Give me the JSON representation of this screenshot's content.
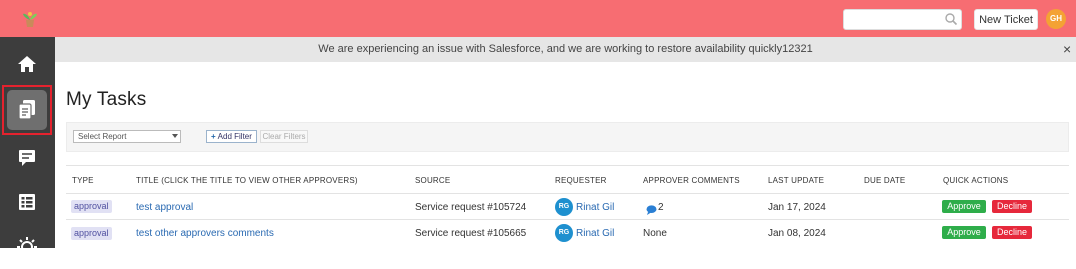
{
  "header": {
    "search_placeholder": "",
    "new_ticket_label": "New Ticket",
    "user_initials": "GH",
    "brand_color": "#f76d72"
  },
  "sidebar": {
    "items": [
      {
        "icon": "home-icon"
      },
      {
        "icon": "tasks-icon",
        "active": true
      },
      {
        "icon": "messages-icon"
      },
      {
        "icon": "list-icon"
      },
      {
        "icon": "settings-icon"
      }
    ]
  },
  "banner": {
    "message": "We are experiencing an issue with Salesforce, and we are working to restore availability quickly12321",
    "close_label": "×"
  },
  "page": {
    "title": "My Tasks"
  },
  "filters": {
    "select_report_label": "Select Report",
    "add_filter_label": "Add Filter",
    "clear_filters_label": "Clear Filters"
  },
  "table": {
    "headers": {
      "type": "TYPE",
      "title": "TITLE (CLICK THE TITLE TO VIEW OTHER APPROVERS)",
      "source": "SOURCE",
      "requester": "REQUESTER",
      "approver_comments": "APPROVER COMMENTS",
      "last_update": "LAST UPDATE",
      "due_date": "DUE DATE",
      "quick_actions": "QUICK ACTIONS"
    },
    "rows": [
      {
        "type": "approval",
        "title": "test approval",
        "source": "Service request #105724",
        "requester_initials": "RG",
        "requester_name": "Rinat Gil",
        "approver_comments": "2",
        "last_update": "Jan 17, 2024",
        "due_date": "",
        "approve_label": "Approve",
        "decline_label": "Decline"
      },
      {
        "type": "approval",
        "title": "test other approvers comments",
        "source": "Service request #105665",
        "requester_initials": "RG",
        "requester_name": "Rinat Gil",
        "approver_comments": "None",
        "last_update": "Jan 08, 2024",
        "due_date": "",
        "approve_label": "Approve",
        "decline_label": "Decline"
      }
    ]
  }
}
